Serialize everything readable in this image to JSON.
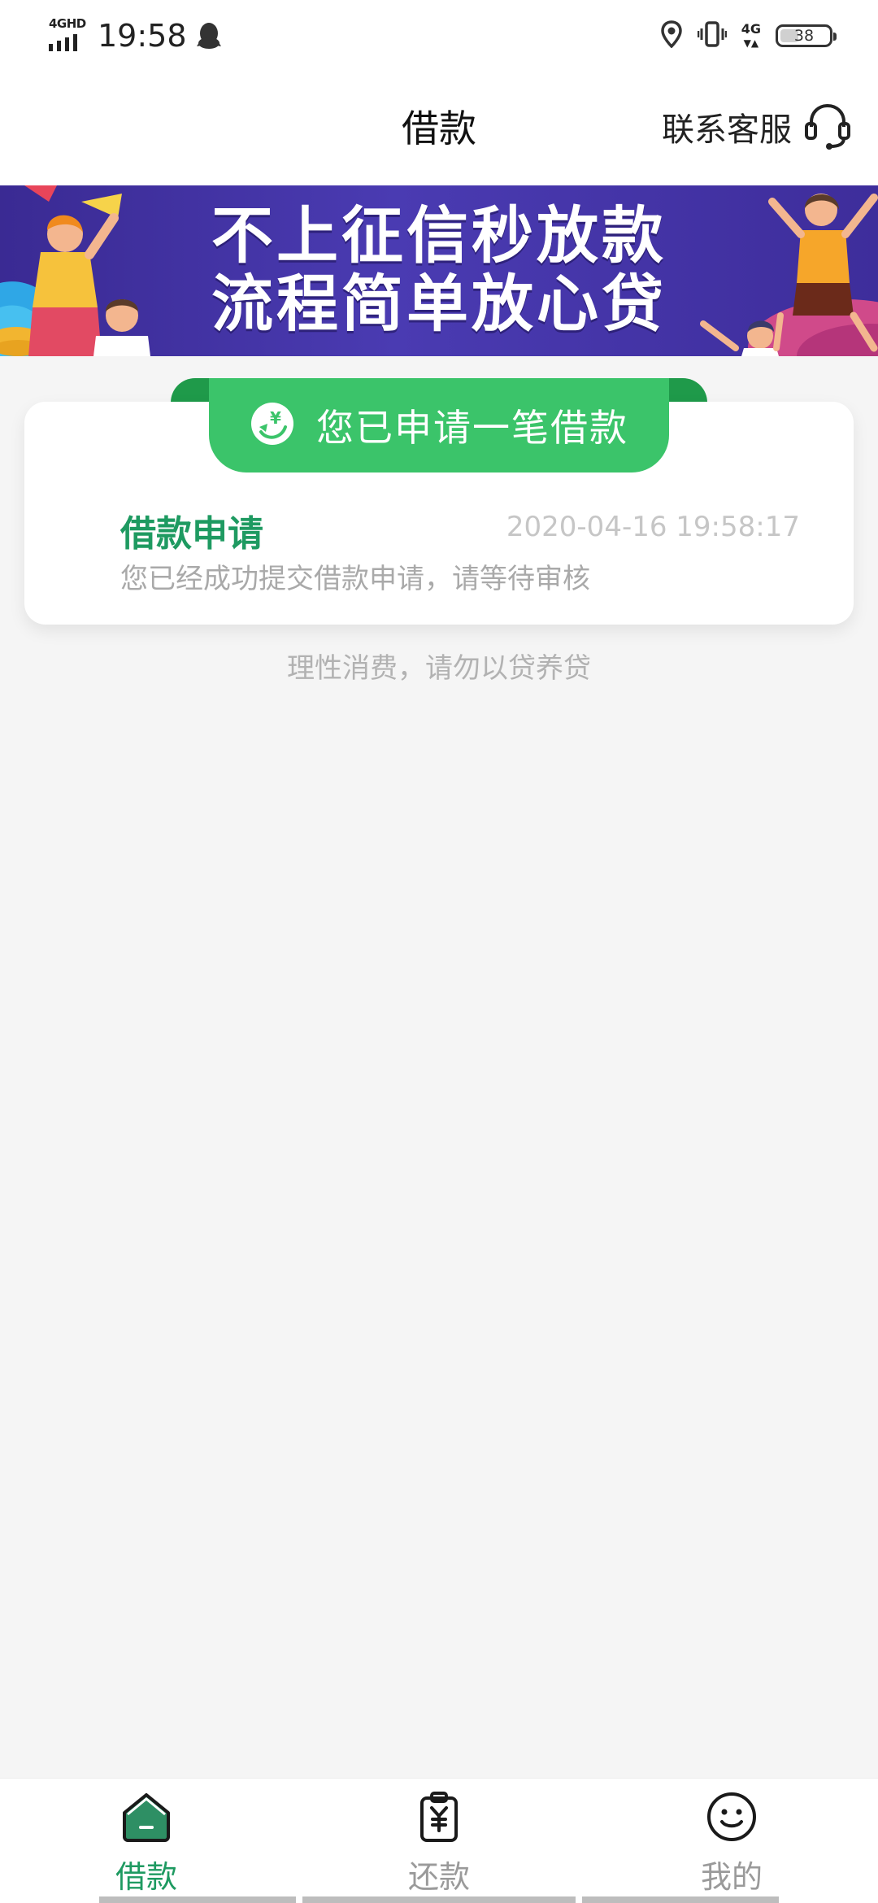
{
  "status_bar": {
    "network_left": "4GHD",
    "time": "19:58",
    "network_right": "4G",
    "battery_level": "38"
  },
  "header": {
    "title": "借款",
    "service_label": "联系客服"
  },
  "banner": {
    "line1": "不上征信秒放款",
    "line2": "流程简单放心贷"
  },
  "card": {
    "badge_label": "您已申请一笔借款",
    "entry_title": "借款申请",
    "entry_time": "2020-04-16 19:58:17",
    "entry_desc": "您已经成功提交借款申请，请等待审核"
  },
  "notice": "理性消费，请勿以贷养贷",
  "bottom_nav": {
    "items": [
      {
        "label": "借款"
      },
      {
        "label": "还款"
      },
      {
        "label": "我的"
      }
    ]
  },
  "colors": {
    "accent_green": "#3bc46a",
    "title_green": "#1e9a61",
    "banner_purple": "#4a3bb2"
  }
}
